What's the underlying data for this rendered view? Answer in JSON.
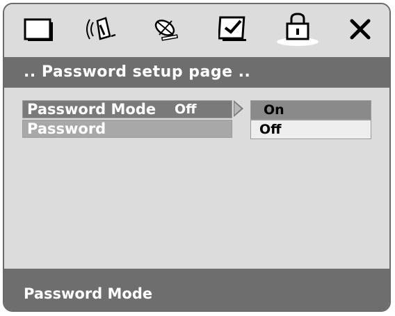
{
  "tabs": [
    {
      "name": "general-setup",
      "icon": "screen-icon",
      "active": false
    },
    {
      "name": "audio-setup",
      "icon": "speaker-icon",
      "active": false
    },
    {
      "name": "video-setup",
      "icon": "satellite-dish-icon",
      "active": false
    },
    {
      "name": "preference-setup",
      "icon": "checkbox-icon",
      "active": false
    },
    {
      "name": "password-setup",
      "icon": "lock-icon",
      "active": true
    },
    {
      "name": "exit",
      "icon": "close-icon",
      "active": false
    }
  ],
  "page": {
    "title": ".. Password setup page .."
  },
  "menu": {
    "items": [
      {
        "label": "Password Mode",
        "value": "Off",
        "selected": true
      },
      {
        "label": "Password",
        "value": "",
        "selected": false
      }
    ]
  },
  "submenu": {
    "options": [
      {
        "label": "On",
        "highlighted": true
      },
      {
        "label": "Off",
        "highlighted": false
      }
    ]
  },
  "status": {
    "text": "Password Mode"
  },
  "colors": {
    "background": "#dcdcdc",
    "bar": "#6e6e6e",
    "selected": "#7a7a7a",
    "highlight": "#8a8a8a"
  }
}
